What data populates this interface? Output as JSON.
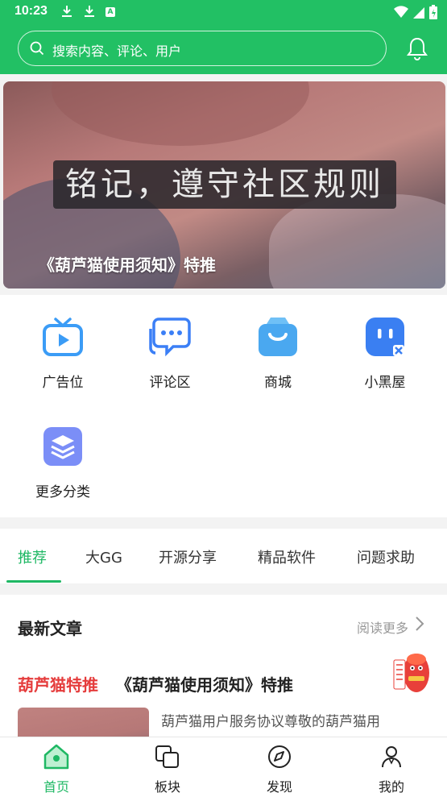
{
  "status_bar": {
    "time": "10:23",
    "a_icon": "A"
  },
  "search": {
    "placeholder": "搜索内容、评论、用户"
  },
  "banner": {
    "overlay_text": "铭记，遵守社区规则",
    "caption": "《葫芦猫使用须知》特推"
  },
  "quick_links": [
    {
      "label": "广告位",
      "icon": "tv-icon",
      "color": "#3b9cf6"
    },
    {
      "label": "评论区",
      "icon": "chat-icon",
      "color": "#3b7ff6"
    },
    {
      "label": "商城",
      "icon": "shop-bag-icon",
      "color": "#4aa8f0"
    },
    {
      "label": "小黑屋",
      "icon": "blackroom-icon",
      "color": "#3a7ff2"
    },
    {
      "label": "更多分类",
      "icon": "layers-icon",
      "color": "#7b8ef7"
    }
  ],
  "tabs": [
    {
      "label": "推荐"
    },
    {
      "label": "大GG"
    },
    {
      "label": "开源分享"
    },
    {
      "label": "精品软件"
    },
    {
      "label": "问题求助"
    }
  ],
  "articles": {
    "section_title": "最新文章",
    "more_label": "阅读更多",
    "item": {
      "tag": "葫芦猫特推",
      "title": "《葫芦猫使用须知》特推",
      "excerpt": "葫芦猫用户服务协议尊敬的葫芦猫用"
    }
  },
  "bottom_nav": [
    {
      "label": "首页",
      "icon": "home-icon"
    },
    {
      "label": "板块",
      "icon": "board-icon"
    },
    {
      "label": "发现",
      "icon": "compass-icon"
    },
    {
      "label": "我的",
      "icon": "profile-icon"
    }
  ],
  "colors": {
    "brand_green": "#22c064",
    "active_tab": "#1fb864",
    "tag_red": "#e53c3c"
  }
}
